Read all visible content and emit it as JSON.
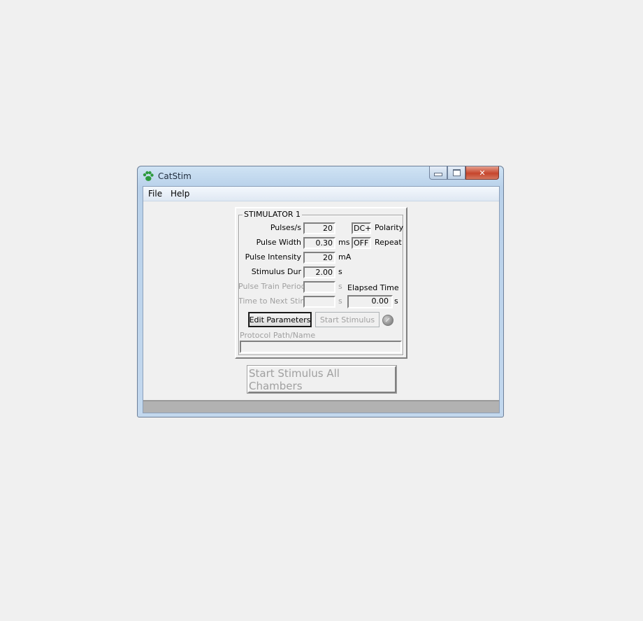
{
  "window": {
    "title": "CatStim",
    "app_icon": "paw-icon"
  },
  "menu": {
    "file": "File",
    "help": "Help"
  },
  "stimulator": {
    "title": "STIMULATOR 1",
    "pulses_label": "Pulses/s",
    "pulses_value": "20",
    "polarity_value": "DC+",
    "polarity_label": "Polarity",
    "pulse_width_label": "Pulse Width",
    "pulse_width_value": "0.30",
    "pulse_width_unit": "ms",
    "repeat_value": "OFF",
    "repeat_label": "Repeat",
    "intensity_label": "Pulse Intensity",
    "intensity_value": "20",
    "intensity_unit": "mA",
    "duration_label": "Stimulus Dur",
    "duration_value": "2.00",
    "duration_unit": "s",
    "train_period_label": "Pulse Train Period",
    "train_period_value": "",
    "train_period_unit": "s",
    "elapsed_label": "Elapsed Time",
    "next_stim_label": "Time to Next Stim",
    "next_stim_value": "",
    "next_stim_unit": "s",
    "elapsed_value": "0.00",
    "elapsed_unit": "s",
    "edit_button": "Edit Parameters",
    "start_button": "Start Stimulus",
    "status_led": "status-led-icon",
    "protocol_label": "Protocol Path/Name",
    "protocol_value": ""
  },
  "start_all_button": "Start Stimulus All Chambers",
  "colors": {
    "disabled_text": "#a0a0a0",
    "statusbar": "#b2b2b2",
    "close_button": "#c6452c"
  }
}
